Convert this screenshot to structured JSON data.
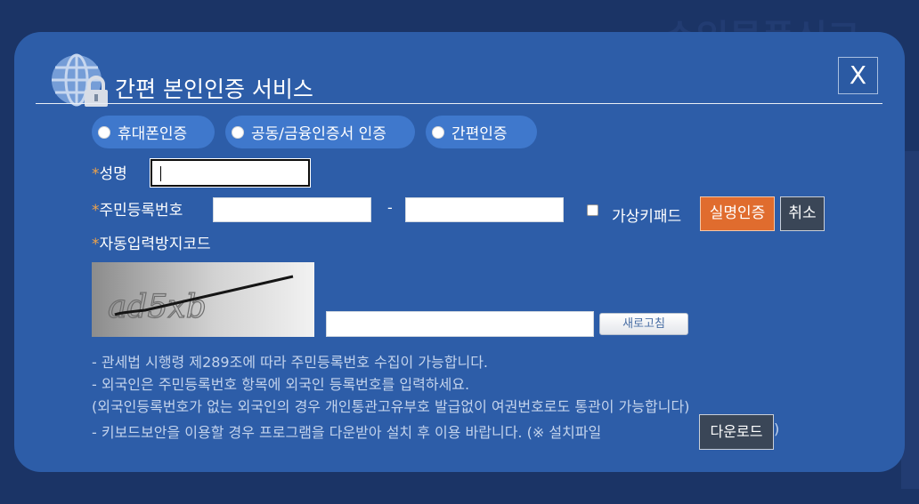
{
  "background": {
    "text": "수입물품신고"
  },
  "modal": {
    "title": "간편 본인인증 서비스",
    "close_label": "X",
    "auth_options": [
      "휴대폰인증",
      "공동/금융인증서 인증",
      "간편인증"
    ]
  },
  "form": {
    "name_label": "성명",
    "name_value": "",
    "rrn_label": "주민등록번호",
    "rrn_front_value": "",
    "rrn_back_value": "",
    "rrn_separator": "-",
    "virtual_keypad_label": "가상키패드",
    "verify_button": "실명인증",
    "cancel_button": "취소",
    "captcha_label": "자동입력방지코드",
    "captcha_text": "ad5xb",
    "captcha_value": "",
    "refresh_button": "새로고침",
    "required_mark": "*"
  },
  "notes": {
    "line1": "- 관세법 시행령 제289조에 따라 주민등록번호 수집이 가능합니다.",
    "line2": "- 외국인은 주민등록번호 항목에 외국인 등록번호를 입력하세요.",
    "line3": "(외국인등록번호가 없는 외국인의 경우 개인통관고유부호 발급없이 여권번호로도 통관이 가능합니다)",
    "line4": "- 키보드보안을 이용할 경우 프로그램을 다운받아 설치 후 이용 바랍니다. (※ 설치파일",
    "line4_end": ")",
    "download_button": "다운로드"
  },
  "colors": {
    "background": "#1b3466",
    "modal": "#2d5da8",
    "pill": "#3f78cc",
    "accent_orange": "#e06c2e",
    "dark_button": "#3a4657",
    "required_star": "#f0a44a"
  },
  "icons": {
    "header": "globe-lock-icon",
    "close": "close-icon",
    "radio": "radio-icon",
    "checkbox": "checkbox-icon"
  }
}
